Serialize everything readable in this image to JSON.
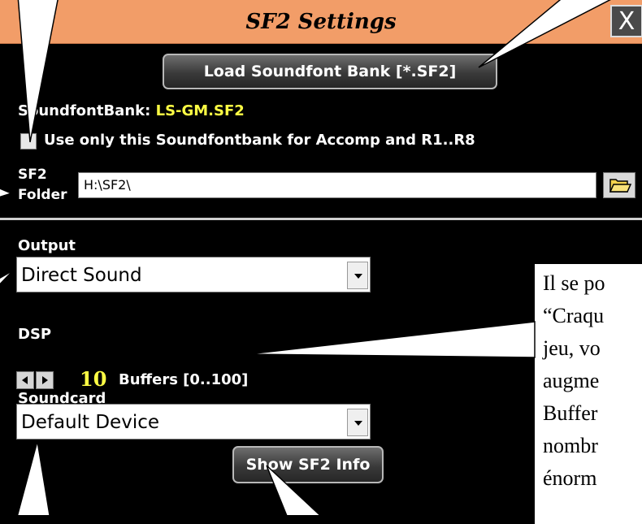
{
  "window": {
    "title": "SF2 Settings",
    "close_label": "X"
  },
  "soundfont": {
    "load_button": "Load Soundfont Bank [*.SF2]",
    "bank_label": "SoundfontBank:",
    "bank_value": "LS-GM.SF2",
    "checkbox_label": "Use only this Soundfontbank for Accomp and R1..R8",
    "checkbox_checked": false,
    "folder_label_line1": "SF2",
    "folder_label_line2": "Folder",
    "folder_value": "H:\\SF2\\"
  },
  "output": {
    "label": "Output",
    "value": "Direct Sound"
  },
  "dsp": {
    "label": "DSP",
    "buffers_value": "10",
    "buffers_label": "Buffers [0..100]"
  },
  "soundcard": {
    "label": "Soundcard",
    "value": "Default Device"
  },
  "info_button": "Show SF2 Info",
  "annotation_text": "Il se po\n“Craqu\njeu, vo\naugme\nBuffer\nnombr\nénorm",
  "colors": {
    "titlebar": "#f29d68",
    "accent_text": "#ffff44",
    "background": "#000000"
  }
}
